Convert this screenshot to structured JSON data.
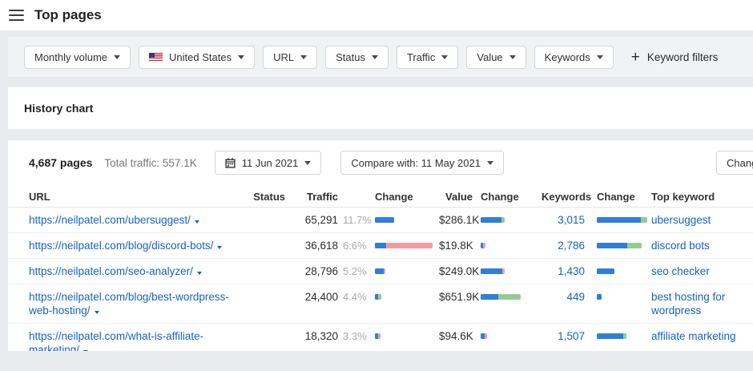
{
  "header": {
    "title": "Top pages"
  },
  "filters": {
    "plus_icon": "+",
    "keyword_filters_label": "Keyword filters",
    "dropdowns": [
      {
        "label": "Monthly volume"
      },
      {
        "label": "United States"
      },
      {
        "label": "URL"
      },
      {
        "label": "Status"
      },
      {
        "label": "Traffic"
      },
      {
        "label": "Value"
      },
      {
        "label": "Keywords"
      }
    ]
  },
  "history": {
    "title": "History chart"
  },
  "toolbar": {
    "pages_count": "4,687 pages",
    "total_traffic": "Total traffic: 557.1K",
    "date_button": "11 Jun 2021",
    "compare_button": "Compare with: 11 May 2021",
    "changes_button": "Changes"
  },
  "colors": {
    "link": "#1563c5",
    "bar_blue": "#2f80d4",
    "bar_red": "#f59ba0",
    "bar_green": "#96cb94"
  },
  "table": {
    "columns": [
      "URL",
      "Status",
      "Traffic",
      "Change",
      "Value",
      "Change",
      "Keywords",
      "Change",
      "Top keyword"
    ],
    "rows": [
      {
        "url": "https://neilpatel.com/ubersuggest/",
        "status": "",
        "traffic": "65,291",
        "traffic_pct": "11.7%",
        "traffic_change": [
          [
            "blue",
            24
          ]
        ],
        "value": "$286.1K",
        "value_change": [
          [
            "blue",
            26
          ],
          [
            "green",
            4
          ]
        ],
        "keywords": "3,015",
        "keywords_change": [
          [
            "blue",
            55
          ],
          [
            "green",
            8
          ]
        ],
        "top_keyword": "ubersuggest"
      },
      {
        "url": "https://neilpatel.com/blog/discord-bots/",
        "status": "",
        "traffic": "36,618",
        "traffic_pct": "6.6%",
        "traffic_change": [
          [
            "blue",
            14
          ],
          [
            "red",
            58
          ]
        ],
        "value": "$19.8K",
        "value_change": [
          [
            "blue",
            3
          ],
          [
            "red",
            3
          ]
        ],
        "keywords": "2,786",
        "keywords_change": [
          [
            "blue",
            38
          ],
          [
            "green",
            18
          ]
        ],
        "top_keyword": "discord bots"
      },
      {
        "url": "https://neilpatel.com/seo-analyzer/",
        "status": "",
        "traffic": "28,796",
        "traffic_pct": "5.2%",
        "traffic_change": [
          [
            "blue",
            11
          ],
          [
            "red",
            2
          ]
        ],
        "value": "$249.0K",
        "value_change": [
          [
            "blue",
            27
          ],
          [
            "red",
            3
          ]
        ],
        "keywords": "1,430",
        "keywords_change": [
          [
            "blue",
            22
          ]
        ],
        "top_keyword": "seo checker"
      },
      {
        "url": "https://neilpatel.com/blog/best-wordpress-web-hosting/",
        "status": "",
        "traffic": "24,400",
        "traffic_pct": "4.4%",
        "traffic_change": [
          [
            "blue",
            4
          ],
          [
            "green",
            4
          ]
        ],
        "value": "$651.9K",
        "value_change": [
          [
            "blue",
            22
          ],
          [
            "green",
            28
          ]
        ],
        "keywords": "449",
        "keywords_change": [
          [
            "blue",
            6
          ]
        ],
        "top_keyword": "best hosting for wordpress"
      },
      {
        "url": "https://neilpatel.com/what-is-affiliate-marketing/",
        "status": "",
        "traffic": "18,320",
        "traffic_pct": "3.3%",
        "traffic_change": [
          [
            "blue",
            4
          ],
          [
            "red",
            3
          ]
        ],
        "value": "$94.6K",
        "value_change": [
          [
            "blue",
            5
          ],
          [
            "red",
            3
          ]
        ],
        "keywords": "1,507",
        "keywords_change": [
          [
            "blue",
            33
          ],
          [
            "green",
            4
          ]
        ],
        "top_keyword": "affiliate marketing"
      }
    ]
  }
}
